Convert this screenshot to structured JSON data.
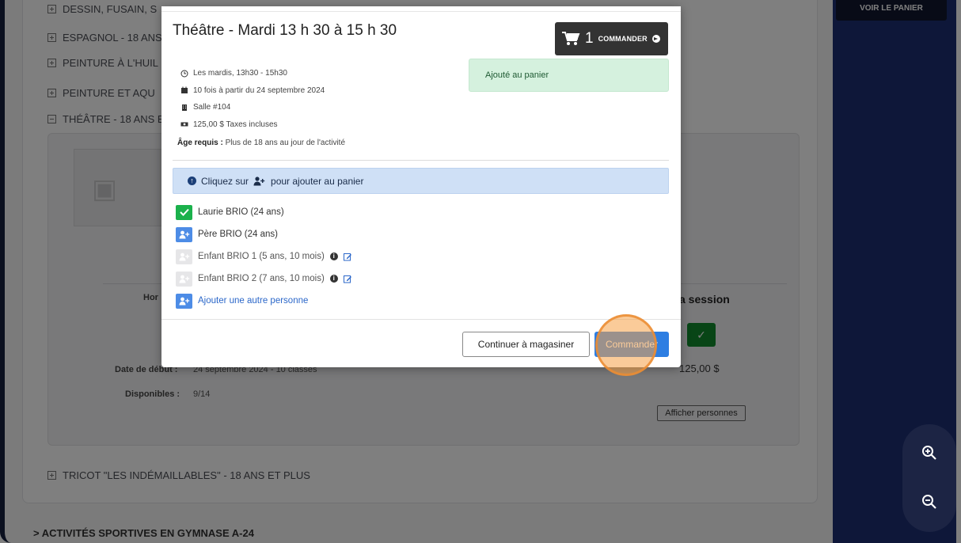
{
  "background": {
    "voir_panier": "VOIR LE PANIER",
    "accordion": [
      "DESSIN, FUSAIN, S",
      "ESPAGNOL - 18 ans",
      "PEINTURE À L'HUIL",
      "PEINTURE ET AQU",
      "THÉÂTRE - 18 ans e"
    ],
    "horaire_label": "Hor",
    "date_debut_label": "Date de début :",
    "date_debut_value": "24 septembre 2024 - 10 classes",
    "disponibles_label": "Disponibles :",
    "disponibles_value": "9/14",
    "session_header": "a session",
    "price": "125,00 $",
    "afficher_button": "Afficher personnes",
    "tricot": "TRICOT \"LES INDÉMAILLABLES\" - 18 ans et plus",
    "sportives": "> ACTIVITÉS SPORTIVES EN GYMNASE A-24"
  },
  "modal": {
    "title": "Théâtre - Mardi 13 h 30 à 15 h 30",
    "cart": {
      "count": "1",
      "label": "COMMANDER"
    },
    "alert": "Ajouté au panier",
    "info": [
      {
        "icon": "clock-icon",
        "text": "Les mardis, 13h30 - 15h30"
      },
      {
        "icon": "calendar-icon",
        "text": "10 fois à partir du 24 septembre 2024"
      },
      {
        "icon": "building-icon",
        "text": "Salle #104"
      },
      {
        "icon": "money-icon",
        "text": "125,00 $ Taxes incluses"
      }
    ],
    "age_label": "Âge requis :",
    "age_value": "Plus de 18 ans au jour de l'activité",
    "hint_prefix": "Cliquez sur",
    "hint_suffix": "pour ajouter au panier",
    "persons": [
      {
        "name": "Laurie BRIO (24 ans)",
        "state": "checked"
      },
      {
        "name": "Père BRIO (24 ans)",
        "state": "add"
      },
      {
        "name": "Enfant BRIO 1 (5 ans, 10 mois)",
        "state": "disabled"
      },
      {
        "name": "Enfant BRIO 2 (7 ans, 10 mois)",
        "state": "disabled"
      }
    ],
    "add_person": "Ajouter une autre personne",
    "continue_button": "Continuer à magasiner",
    "commander_button": "Commander"
  },
  "colors": {
    "sidebar_navy": "#1d2f73",
    "success_green": "#1bb14c",
    "primary_blue": "#2d7ee2",
    "alert_green_bg": "#d5f1de",
    "hint_blue_bg": "#cfe0f6"
  }
}
